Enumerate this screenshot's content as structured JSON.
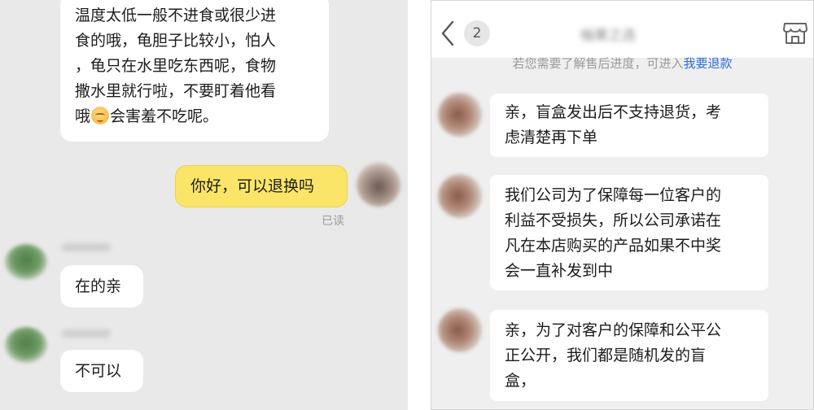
{
  "left_chat": {
    "messages": [
      {
        "sender": "merchant",
        "lines": [
          "温度太低一般不进食或很少进",
          "食的哦，龟胆子比较小，怕人",
          "，龟只在水里吃东西呢，食物",
          "撒水里就行啦，不要盯着他看"
        ],
        "last_line_before_emoji": "哦",
        "emoji": "relieved-face-emoji",
        "last_line_after_emoji": "会害羞不吃呢。"
      },
      {
        "sender": "user",
        "text": "你好，可以退换吗"
      },
      {
        "sender": "merchant",
        "text": "在的亲"
      },
      {
        "sender": "merchant",
        "text": "不可以"
      }
    ],
    "read_receipt": "已读"
  },
  "right_chat": {
    "header": {
      "back_icon": "chevron-left-icon",
      "unread_count": "2",
      "title": "柚果之选",
      "store_icon": "store-icon"
    },
    "system_notice": {
      "text": "若您需要了解售后进度，可进入",
      "link": "我要退款"
    },
    "messages": [
      {
        "lines": [
          "亲，盲盒发出后不支持退货，考",
          "虑清楚再下单"
        ]
      },
      {
        "lines": [
          "我们公司为了保障每一位客户的",
          "利益不受损失，所以公司承诺在",
          "凡在本店购买的产品如果不中奖",
          "会一直补发到中"
        ]
      },
      {
        "lines": [
          "亲，为了对客户的保障和公平公",
          "正公开，我们都是随机发的盲",
          "盒，"
        ]
      }
    ]
  },
  "colors": {
    "left_background": "#e9e9e9",
    "right_background": "#efefef",
    "user_bubble": "#fbe568",
    "link": "#2f6fd6",
    "muted_text": "#9a9a9a"
  }
}
